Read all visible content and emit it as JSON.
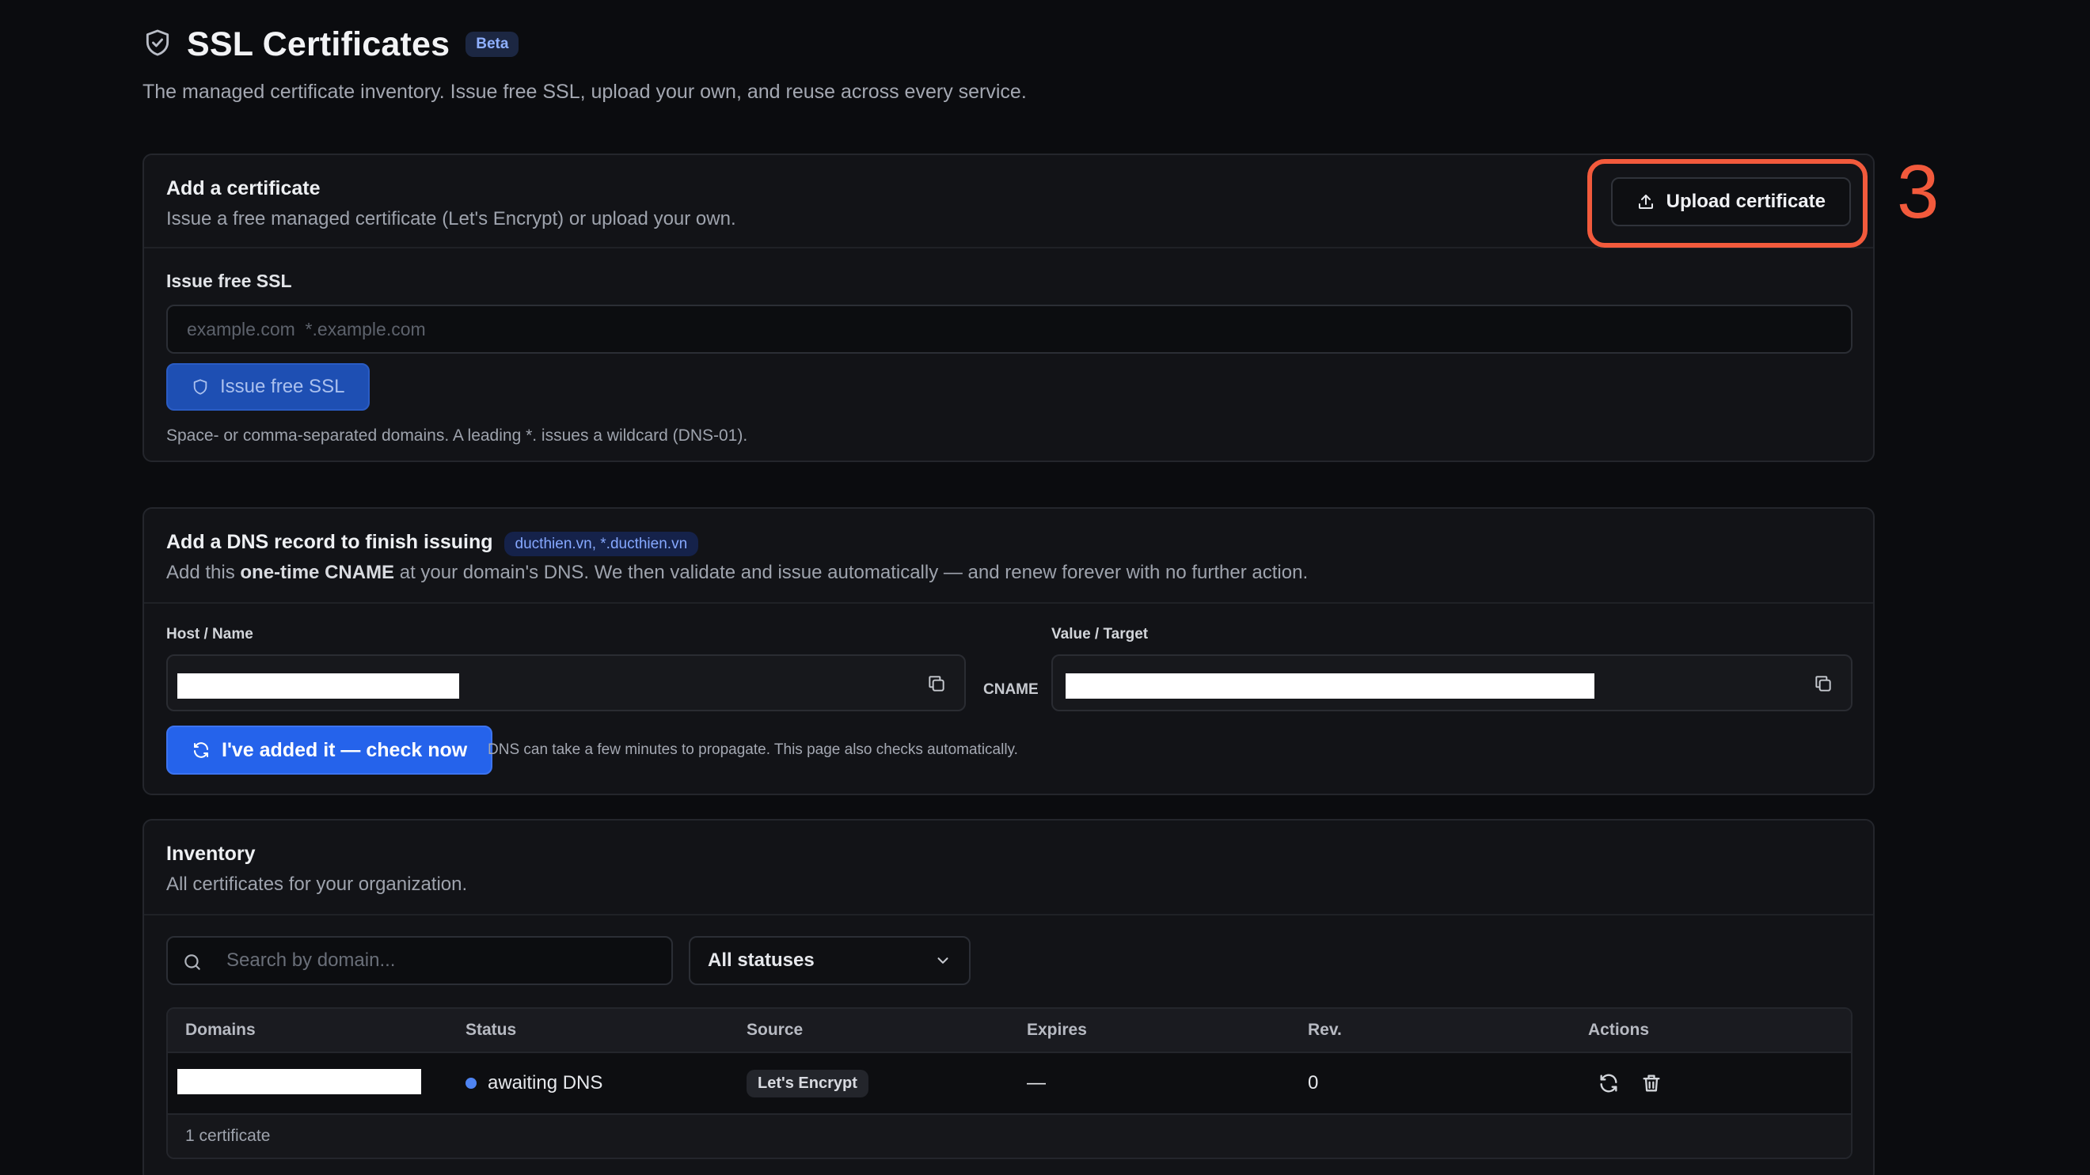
{
  "header": {
    "title": "SSL Certificates",
    "badge": "Beta",
    "subtitle": "The managed certificate inventory. Issue free SSL, upload your own, and reuse across every service."
  },
  "add_certificate": {
    "title": "Add a certificate",
    "subtitle": "Issue a free managed certificate (Let's Encrypt) or upload your own.",
    "upload_button": "Upload certificate",
    "issue_label": "Issue free SSL",
    "domains_placeholder": "example.com  *.example.com",
    "issue_button": "Issue free SSL",
    "hint": "Space- or comma-separated domains. A leading *. issues a wildcard (DNS-01)."
  },
  "annotation": {
    "number": "3",
    "color": "#f25a3c"
  },
  "dns_record": {
    "title": "Add a DNS record to finish issuing",
    "domains_badge": "ducthien.vn, *.ducthien.vn",
    "subtitle_pre": "Add this ",
    "subtitle_bold": "one-time CNAME",
    "subtitle_post": " at your domain's DNS. We then validate and issue automatically — and renew forever with no further action.",
    "host_label": "Host / Name",
    "record_type": "CNAME",
    "value_label": "Value / Target",
    "check_button": "I've added it — check now",
    "check_hint": "DNS can take a few minutes to propagate. This page also checks automatically."
  },
  "inventory": {
    "title": "Inventory",
    "subtitle": "All certificates for your organization.",
    "search_placeholder": "Search by domain...",
    "status_filter": "All statuses",
    "columns": [
      "Domains",
      "Status",
      "Source",
      "Expires",
      "Rev.",
      "Actions"
    ],
    "rows": [
      {
        "status": "awaiting DNS",
        "source": "Let's Encrypt",
        "expires": "—",
        "rev": "0"
      }
    ],
    "footer": "1 certificate"
  },
  "colors": {
    "accent": "#2563eb",
    "status_awaiting": "#4f84f2",
    "background": "#0b0c0f"
  }
}
